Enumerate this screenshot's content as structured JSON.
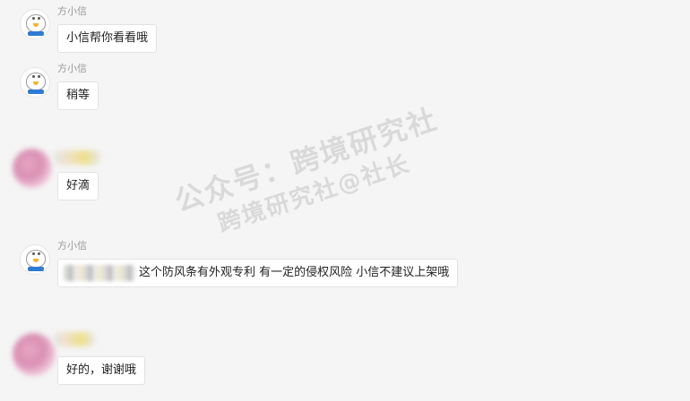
{
  "messages": [
    {
      "sender": "方小信",
      "text": "小信帮你看看哦"
    },
    {
      "sender": "方小信",
      "text": "稍等"
    },
    {
      "sender": "",
      "text": "好滴"
    },
    {
      "sender": "方小信",
      "text": "这个防风条有外观专利 有一定的侵权风险 小信不建议上架哦"
    },
    {
      "sender": "",
      "text": "好的，谢谢哦"
    }
  ],
  "watermark": {
    "line1": "公众号：跨境研究社",
    "line2": "跨境研究社@社长"
  },
  "colors": {
    "background": "#f5f5f5",
    "bubble": "#ffffff",
    "sender_name": "#9a9a9a"
  }
}
